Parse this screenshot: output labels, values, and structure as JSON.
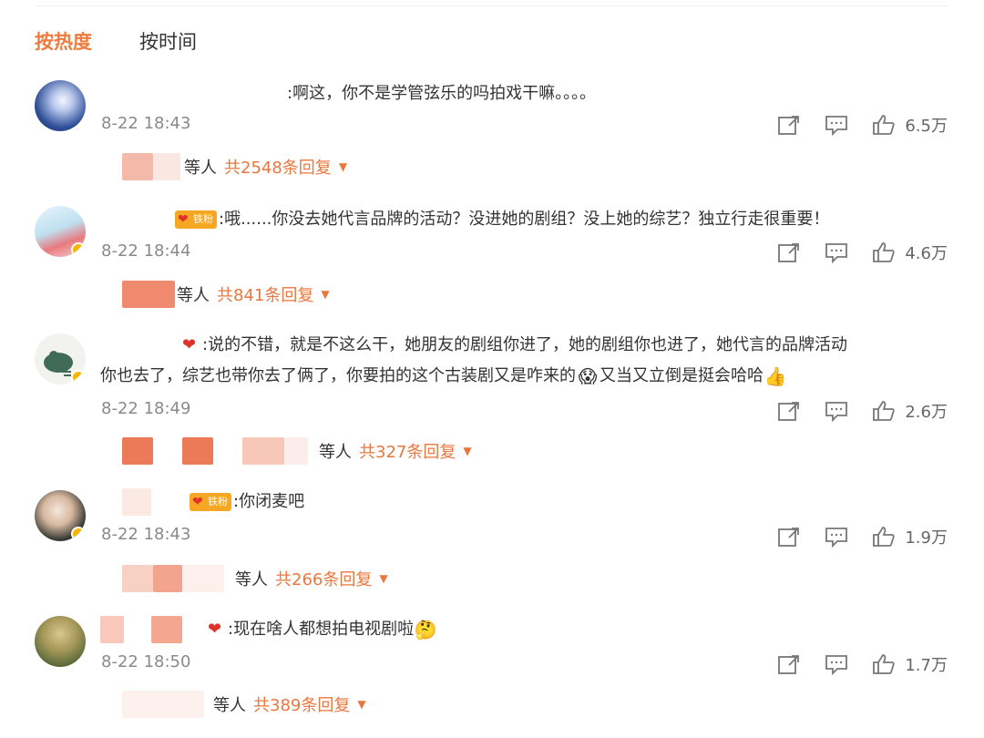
{
  "tabs": {
    "hot": "按热度",
    "time": "按时间"
  },
  "badge_label": "铁粉",
  "reply_suffix": "等人",
  "comments": [
    {
      "text": ":啊这，你不是学管弦乐的吗拍戏干嘛。。。。",
      "time": "8-22 18:43",
      "likes": "6.5万",
      "reply_count": "共2548条回复"
    },
    {
      "text": ":哦......你没去她代言品牌的活动？没进她的剧组？没上她的综艺？独立行走很重要！",
      "time": "8-22 18:44",
      "likes": "4.6万",
      "reply_count": "共841条回复"
    },
    {
      "text1": ":说的不错，就是不这么干，她朋友的剧组你进了，她的剧组你也进了，她代言的品牌活动",
      "text2": "你也去了，综艺也带你去了俩了，你要拍的这个古装剧又是咋来的",
      "text3": "又当又立倒是挺会哈哈",
      "time": "8-22 18:49",
      "likes": "2.6万",
      "reply_count": "共327条回复"
    },
    {
      "text": ":你闭麦吧",
      "time": "8-22 18:43",
      "likes": "1.9万",
      "reply_count": "共266条回复"
    },
    {
      "text": ":现在啥人都想拍电视剧啦",
      "time": "8-22 18:50",
      "likes": "1.7万",
      "reply_count": "共389条回复"
    }
  ],
  "icons": {
    "share": "share-icon",
    "comment": "comment-icon",
    "like": "thumbs-up-icon",
    "caret": "caret-down-icon"
  },
  "colors": {
    "accent": "#f07b3f",
    "reply_accent": "#e9773f",
    "meta": "#8a8a8a"
  }
}
